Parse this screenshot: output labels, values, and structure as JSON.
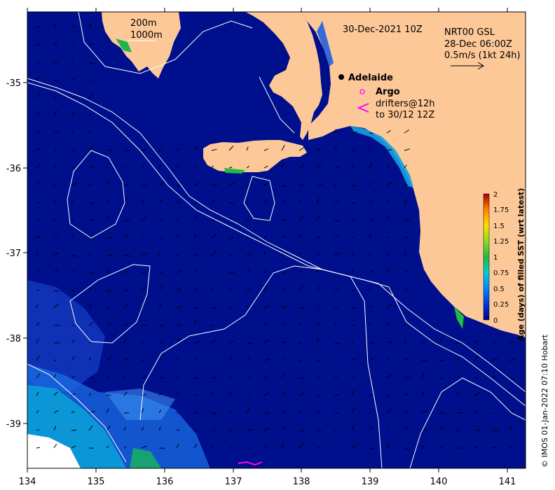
{
  "map": {
    "date_label": "30-Dec-2021 10Z",
    "depth_legend": [
      "200m",
      "1000m"
    ],
    "nrt": {
      "product": "NRT00 GSL",
      "date": "28-Dec 06:00Z",
      "scale": "0.5m/s (1kt 24h)"
    },
    "city": "Adelaide",
    "argo_label": "Argo",
    "drifters_label": [
      "drifters@12h",
      "to 30/12 12Z"
    ],
    "x_ticks": [
      "134",
      "135",
      "136",
      "137",
      "138",
      "139",
      "140",
      "141"
    ],
    "y_ticks": [
      "-35",
      "-36",
      "-37",
      "-38",
      "-39"
    ],
    "colorbar": {
      "label": "Age (days) of filled SST (wrt latest)",
      "ticks": [
        "2",
        "1.75",
        "1.5",
        "1.25",
        "1",
        "0.75",
        "0.5",
        "0.25",
        "0"
      ]
    },
    "credit": "© IMOS 01-Jan-2022 07:10 Hobart",
    "colors": {
      "ocean": "#000f8c",
      "land": "#fdc898",
      "argo": "#ff00ff",
      "drifter": "#ff00ff"
    }
  }
}
